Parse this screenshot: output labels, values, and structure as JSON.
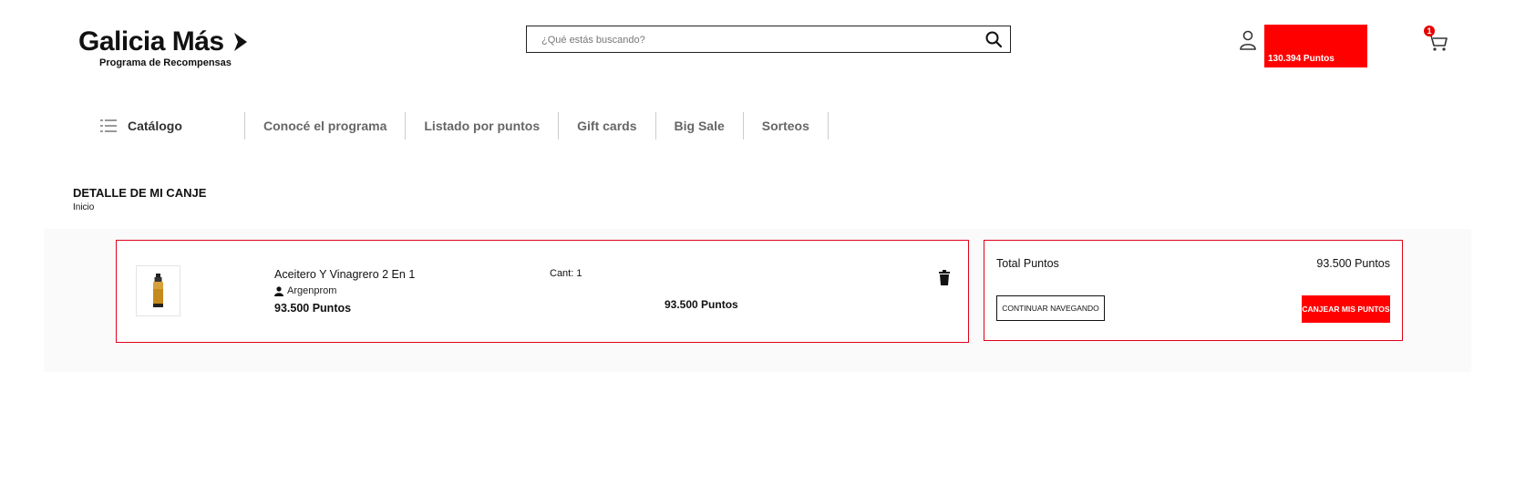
{
  "header": {
    "logo_text": "Galicia Más",
    "logo_subtitle": "Programa de Recompensas",
    "search_placeholder": "¿Qué estás buscando?",
    "user_points": "130.394 Puntos",
    "cart_count": "1"
  },
  "nav": {
    "catalog_label": "Catálogo",
    "items": [
      "Conocé el programa",
      "Listado por puntos",
      "Gift cards",
      "Big Sale",
      "Sorteos"
    ]
  },
  "page": {
    "title": "DETALLE DE MI CANJE",
    "breadcrumb": "Inicio"
  },
  "cart_item": {
    "name": "Aceitero Y Vinagrero 2 En 1",
    "vendor": "Argenprom",
    "points": "93.500 Puntos",
    "quantity_label": "Cant: 1",
    "line_total": "93.500 Puntos"
  },
  "summary": {
    "total_label": "Total Puntos",
    "total_value": "93.500 Puntos",
    "continue_label": "CONTINUAR NAVEGANDO",
    "redeem_label": "CANJEAR MIS PUNTOS"
  },
  "colors": {
    "accent": "#ff0000",
    "border_accent": "#e2001a",
    "band_bg": "#fafafa"
  },
  "icons": [
    "logo-arrow-icon",
    "search-icon",
    "user-icon",
    "cart-icon",
    "list-icon",
    "person-icon",
    "trash-icon"
  ]
}
